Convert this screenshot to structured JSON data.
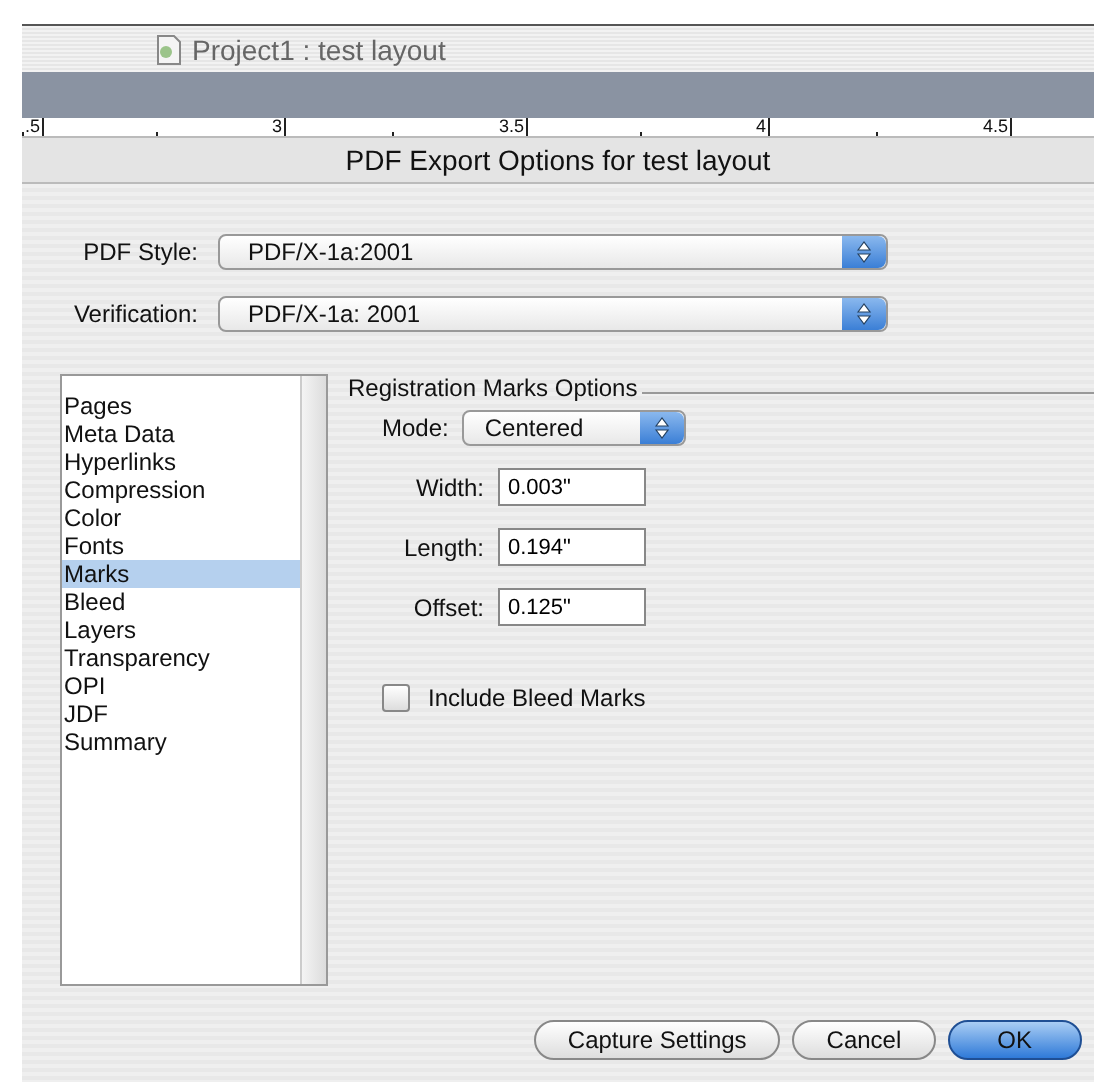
{
  "window": {
    "title": "Project1 : test layout"
  },
  "ruler": {
    "labels": [
      ".5",
      "3",
      "3.5",
      "4",
      "4.5"
    ]
  },
  "dialog": {
    "title": "PDF Export Options for test layout",
    "popups": [
      {
        "label": "PDF Style:",
        "value": "PDF/X-1a:2001"
      },
      {
        "label": "Verification:",
        "value": "PDF/X-1a: 2001"
      }
    ],
    "sidebar": {
      "items": [
        {
          "label": "Pages",
          "selected": false
        },
        {
          "label": "Meta Data",
          "selected": false
        },
        {
          "label": "Hyperlinks",
          "selected": false
        },
        {
          "label": "Compression",
          "selected": false
        },
        {
          "label": "Color",
          "selected": false
        },
        {
          "label": "Fonts",
          "selected": false
        },
        {
          "label": "Marks",
          "selected": true
        },
        {
          "label": "Bleed",
          "selected": false
        },
        {
          "label": "Layers",
          "selected": false
        },
        {
          "label": "Transparency",
          "selected": false
        },
        {
          "label": "OPI",
          "selected": false
        },
        {
          "label": "JDF",
          "selected": false
        },
        {
          "label": "Summary",
          "selected": false
        }
      ]
    },
    "group": {
      "title": "Registration Marks Options",
      "mode": {
        "label": "Mode:",
        "value": "Centered"
      },
      "fields": [
        {
          "label": "Width:",
          "value": "0.003\""
        },
        {
          "label": "Length:",
          "value": "0.194\""
        },
        {
          "label": "Offset:",
          "value": "0.125\""
        }
      ],
      "checkbox": {
        "label": "Include Bleed Marks",
        "checked": false
      }
    },
    "buttons": [
      {
        "label": "Capture Settings",
        "default": false
      },
      {
        "label": "Cancel",
        "default": false
      },
      {
        "label": "OK",
        "default": true
      }
    ]
  }
}
